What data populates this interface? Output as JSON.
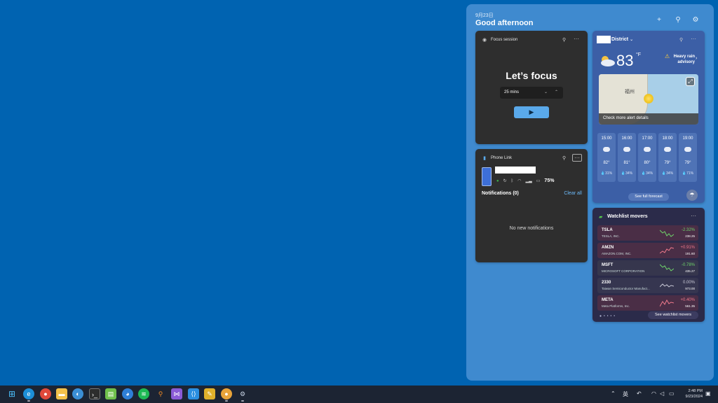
{
  "panel": {
    "date": "9月23日",
    "greeting": "Good afternoon",
    "add_icon": "+",
    "link_icon": "⚲",
    "settings_icon": "⚙"
  },
  "focus": {
    "title": "Focus session",
    "heading": "Let’s focus",
    "duration": "25 mins",
    "play_icon": "▶",
    "pin_icon": "⚲",
    "more_icon": "···"
  },
  "phone": {
    "title": "Phone Link",
    "battery": "75%",
    "notifications_label": "Notifications (0)",
    "clear_all": "Clear all",
    "empty": "No new notifications"
  },
  "weather": {
    "location": "District",
    "temp": "83",
    "unit": "°F",
    "alert_line1": "Heavy rain",
    "alert_line2": "advisory",
    "map_label": "福州",
    "alert_details": "Check more alert details",
    "see_forecast": "See full forecast",
    "hours": [
      {
        "time": "15:00",
        "temp": "82°",
        "precip": "31%"
      },
      {
        "time": "16:00",
        "temp": "81°",
        "precip": "34%"
      },
      {
        "time": "17:00",
        "temp": "80°",
        "precip": "34%"
      },
      {
        "time": "18:00",
        "temp": "79°",
        "precip": "34%"
      },
      {
        "time": "19:00",
        "temp": "79°",
        "precip": "71%"
      }
    ]
  },
  "watchlist": {
    "title": "Watchlist movers",
    "see_movers": "See watchlist movers",
    "colors": {
      "down": "#6fd46a",
      "up": "#f07a8c",
      "flat": "#c9c9d6"
    },
    "rows": [
      {
        "symbol": "TSLA",
        "name": "TESLA, INC.",
        "change": "-2.32%",
        "price": "238.25"
      },
      {
        "symbol": "AMZN",
        "name": "AMAZON.COM, INC.",
        "change": "+0.91%",
        "price": "191.60"
      },
      {
        "symbol": "MSFT",
        "name": "MICROSOFT CORPORATION",
        "change": "-0.78%",
        "price": "435.27"
      },
      {
        "symbol": "2330",
        "name": "Taiwan Semiconductor Manufact...",
        "change": "0.00%",
        "price": "973.00"
      },
      {
        "symbol": "META",
        "name": "Meta Platforms, Inc.",
        "change": "+0.40%",
        "price": "561.35"
      }
    ]
  },
  "taskbar": {
    "apps": [
      "start-icon",
      "edge-icon",
      "chrome-icon",
      "file-explorer-icon",
      "browser-icon",
      "terminal-icon",
      "notepad-icon",
      "edge-dev-icon",
      "spotify-icon",
      "search-app-icon",
      "visual-studio-icon",
      "vscode-icon",
      "paint-icon",
      "chrome-canary-icon",
      "settings-icon"
    ],
    "ime": "英",
    "time": "2:48 PM",
    "date": "9/23/2024"
  }
}
